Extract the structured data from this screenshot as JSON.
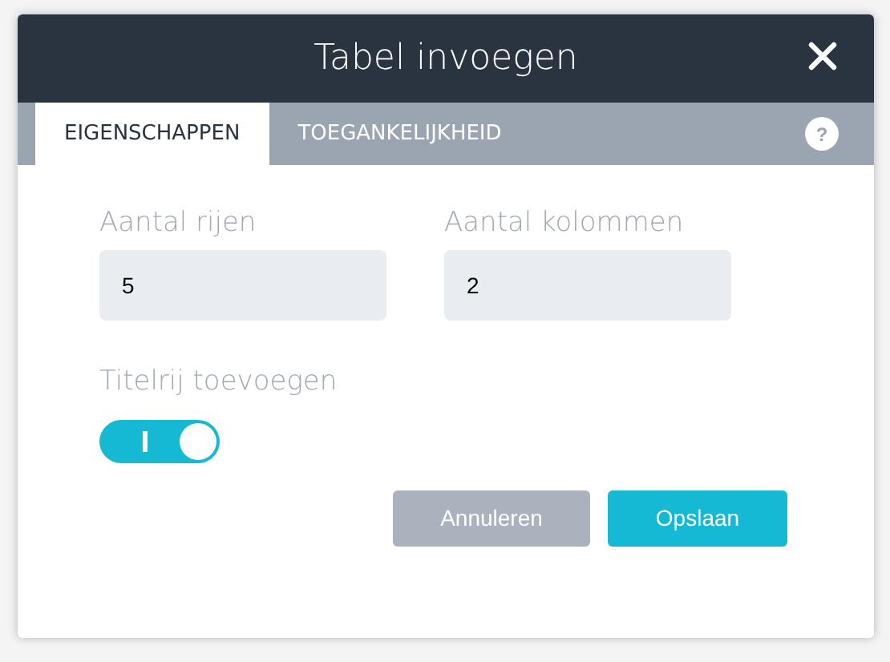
{
  "dialog": {
    "title": "Tabel invoegen"
  },
  "tabs": [
    {
      "label": "EIGENSCHAPPEN",
      "selected": true
    },
    {
      "label": "TOEGANKELIJKHEID",
      "selected": false
    }
  ],
  "help": {
    "label": "?"
  },
  "fields": [
    {
      "label": "Aantal rijen",
      "value": "5"
    },
    {
      "label": "Aantal kolommen",
      "value": "2"
    }
  ],
  "header_row": {
    "label": "Titelrij toevoegen",
    "on": true
  },
  "buttons": [
    {
      "label": "Annuleren",
      "kind": "secondary"
    },
    {
      "label": "Opslaan",
      "kind": "primary"
    }
  ]
}
